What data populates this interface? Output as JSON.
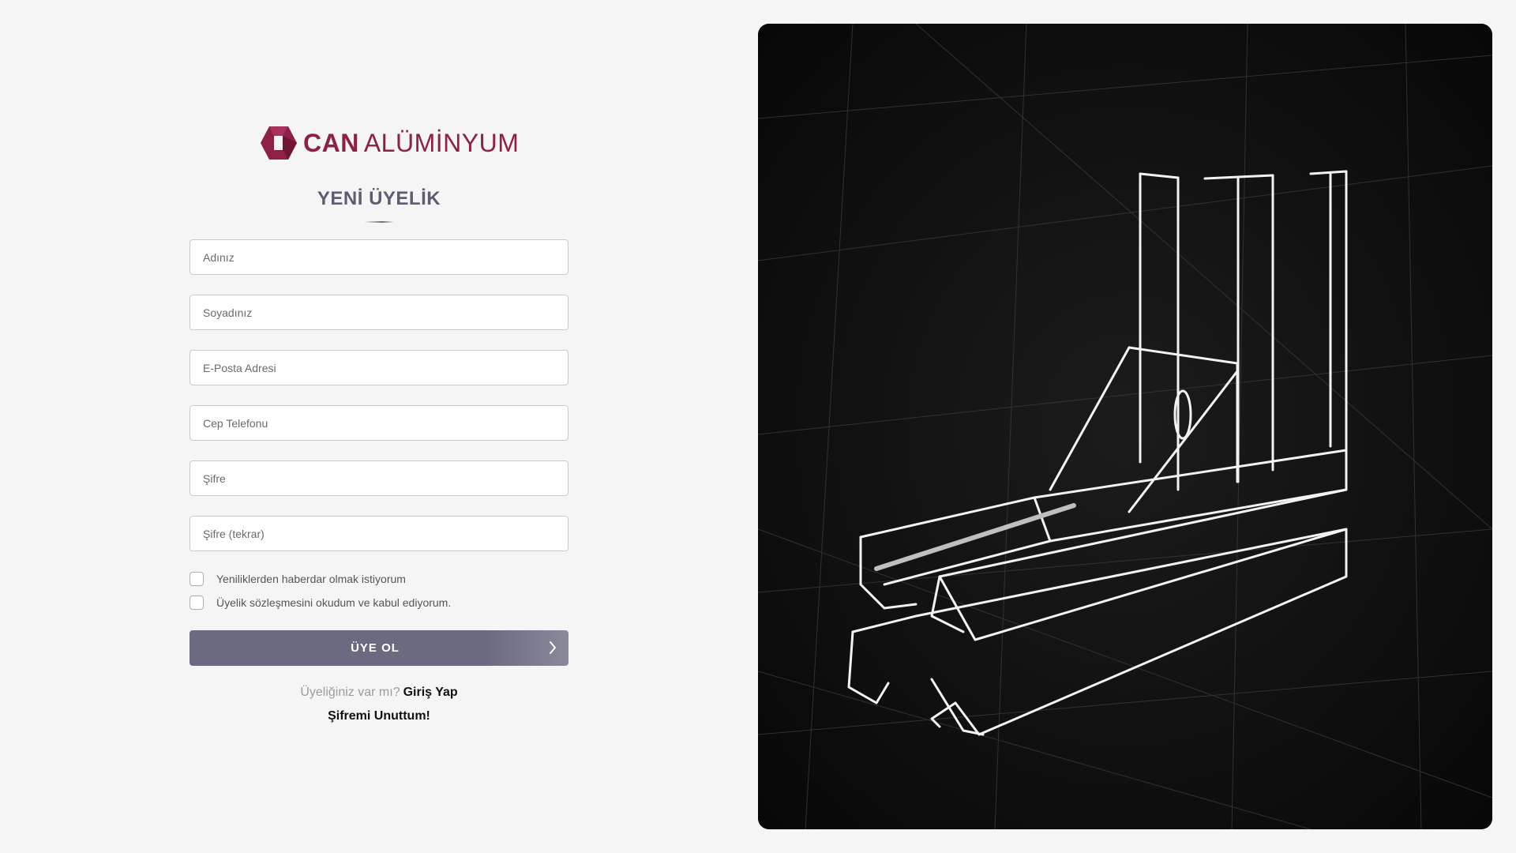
{
  "brand": {
    "name_bold": "CAN",
    "name_light": "ALÜMİNYUM",
    "color": "#8e1f46"
  },
  "form": {
    "title": "YENİ ÜYELİK",
    "fields": {
      "first_name": {
        "placeholder": "Adınız",
        "value": ""
      },
      "last_name": {
        "placeholder": "Soyadınız",
        "value": ""
      },
      "email": {
        "placeholder": "E-Posta Adresi",
        "value": ""
      },
      "phone": {
        "placeholder": "Cep Telefonu",
        "value": ""
      },
      "password": {
        "placeholder": "Şifre",
        "value": ""
      },
      "password_repeat": {
        "placeholder": "Şifre (tekrar)",
        "value": ""
      }
    },
    "checkboxes": {
      "newsletter": {
        "label": "Yeniliklerden haberdar olmak istiyorum",
        "checked": false
      },
      "agreement": {
        "label": "Üyelik sözleşmesini okudum ve kabul ediyorum.",
        "checked": false
      }
    },
    "submit_label": "ÜYE OL",
    "login_prompt": "Üyeliğiniz var mı?",
    "login_link": "Giriş Yap",
    "forgot_link": "Şifremi Unuttum!"
  },
  "colors": {
    "page_bg": "#f5f5f5",
    "button_bg": "#6b6a80",
    "title": "#5d5c70",
    "hero_bg": "#0c0c0c"
  },
  "icons": {
    "logo": "cube-logo-icon",
    "submit": "chevron-right-icon"
  }
}
